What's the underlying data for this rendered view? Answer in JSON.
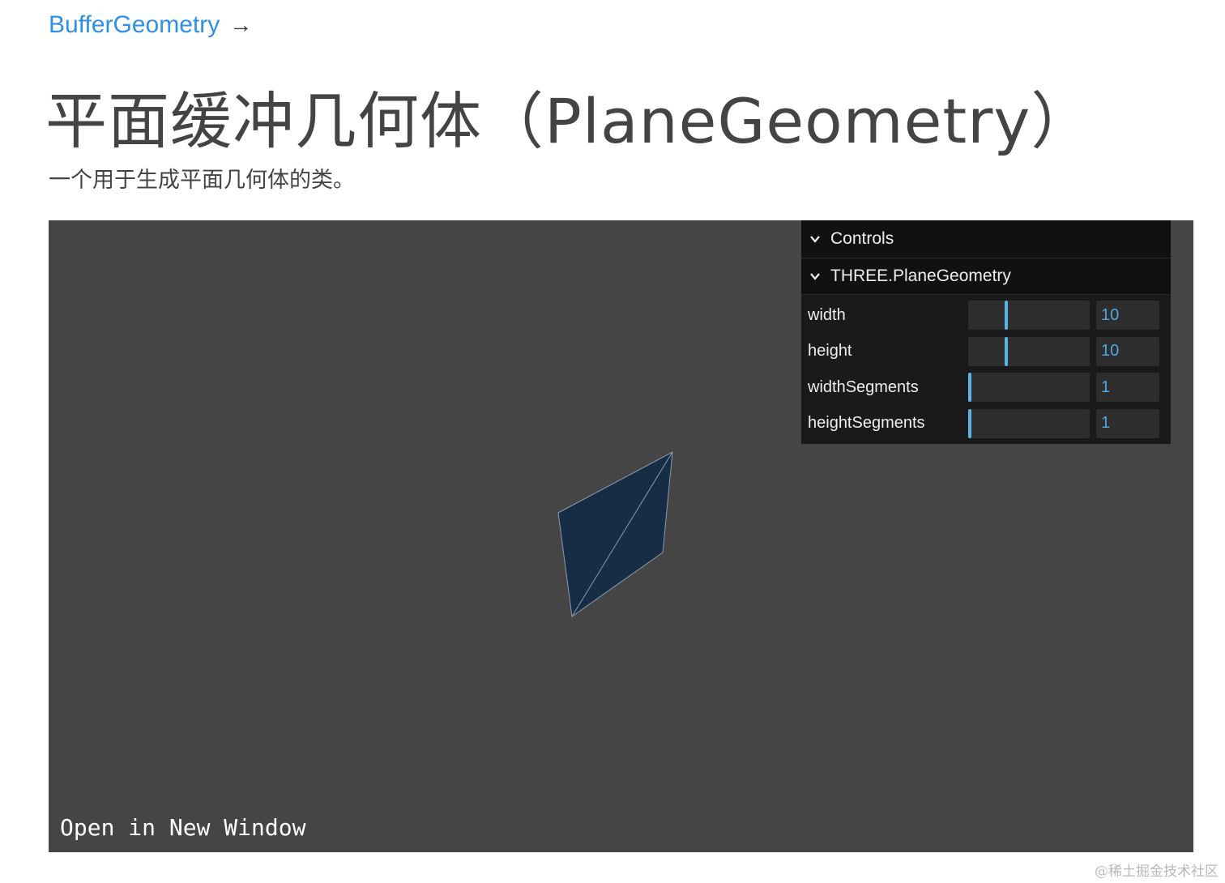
{
  "breadcrumb": {
    "label": "BufferGeometry",
    "arrow": "→"
  },
  "page_title": "平面缓冲几何体（PlaneGeometry）",
  "description": "一个用于生成平面几何体的类。",
  "viewport": {
    "open_in_new_window": "Open in New Window",
    "background": "#454545",
    "mesh_color": "#172d45",
    "edge_color": "#8a9bb0"
  },
  "controls": {
    "header": "Controls",
    "folder": "THREE.PlaneGeometry",
    "accent": "#5ab3e6",
    "params": [
      {
        "label": "width",
        "value": "10",
        "slider_fraction": 0.31
      },
      {
        "label": "height",
        "value": "10",
        "slider_fraction": 0.31
      },
      {
        "label": "widthSegments",
        "value": "1",
        "slider_fraction": 0.0
      },
      {
        "label": "heightSegments",
        "value": "1",
        "slider_fraction": 0.0
      }
    ]
  },
  "watermark": "@稀土掘金技术社区"
}
